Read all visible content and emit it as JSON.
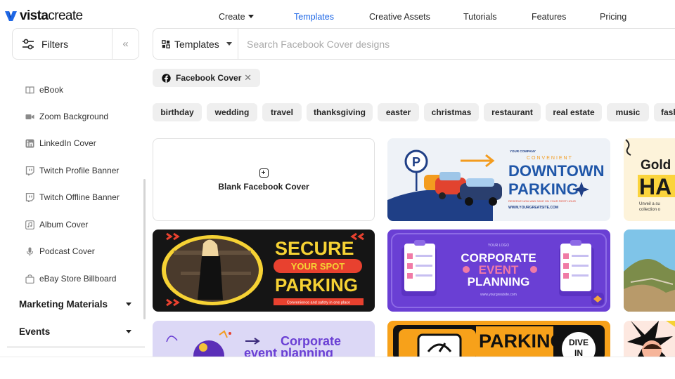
{
  "brand": {
    "name_bold": "vista",
    "name_rest": "create"
  },
  "nav": [
    {
      "label": "Create"
    },
    {
      "label": "Templates"
    },
    {
      "label": "Creative Assets"
    },
    {
      "label": "Tutorials"
    },
    {
      "label": "Features"
    },
    {
      "label": "Pricing"
    }
  ],
  "filters": {
    "label": "Filters"
  },
  "search": {
    "type_label": "Templates",
    "placeholder": "Search Facebook Cover designs"
  },
  "sidebar": {
    "items": [
      {
        "label": "eBook"
      },
      {
        "label": "Zoom Background"
      },
      {
        "label": "LinkedIn Cover"
      },
      {
        "label": "Twitch Profile Banner"
      },
      {
        "label": "Twitch Offline Banner"
      },
      {
        "label": "Album Cover"
      },
      {
        "label": "Podcast Cover"
      },
      {
        "label": "eBay Store Billboard"
      }
    ],
    "sections": [
      {
        "label": "Marketing Materials"
      },
      {
        "label": "Events"
      }
    ]
  },
  "active_filter": {
    "label": "Facebook Cover"
  },
  "tags": [
    "birthday",
    "wedding",
    "travel",
    "thanksgiving",
    "easter",
    "christmas",
    "restaurant",
    "real estate",
    "music",
    "fash"
  ],
  "blank_card": {
    "label": "Blank Facebook Cover"
  },
  "templates": {
    "t1": {
      "company": "YOUR COMPANY",
      "convenient": "CONVENIENT",
      "line1": "DOWNTOWN",
      "line2": "PARKING",
      "sub": "RESERVE NOW AND SAVE ON YOUR FIRST HOUR",
      "site": "WWW.YOURGREATSITE.COM",
      "sign": "P"
    },
    "t2": {
      "line1": "Gold",
      "line2": "HA",
      "sub": "Unveil a su",
      "sub2": "collection o"
    },
    "t3": {
      "line1": "SECURE",
      "line2": "YOUR SPOT",
      "line3": "PARKING",
      "sub": "Convenience and safety in one place"
    },
    "t4": {
      "logo": "YOUR LOGO",
      "line1": "CORPORATE",
      "line2": "EVENT",
      "line3": "PLANNING",
      "site": "www.yourgreatsite.com"
    },
    "t6": {
      "line1": "Corporate",
      "line2": "event planning"
    },
    "t7": {
      "line1": "PARKING",
      "dive1": "DIVE",
      "dive2": "IN"
    }
  },
  "colors": {
    "accent": "#1e67e6",
    "chip_bg": "#efefef",
    "parking_blue": "#1f56a8",
    "parking_orange": "#f39c1f",
    "secure_yellow": "#f6d234",
    "secure_red": "#e8412f",
    "purple": "#6a3fd4",
    "lavender": "#d9d6f5"
  }
}
